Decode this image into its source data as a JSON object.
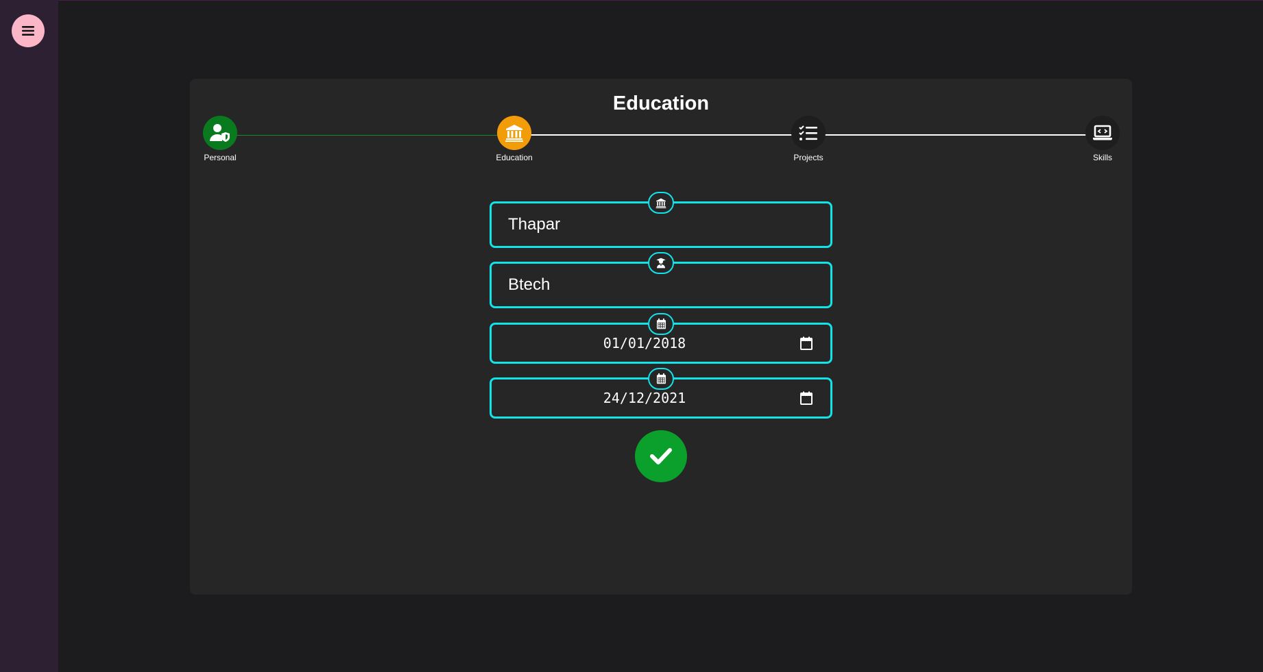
{
  "page": {
    "title": "Education"
  },
  "menu": {
    "icon": "hamburger-icon"
  },
  "stepper": {
    "steps": [
      {
        "label": "Personal",
        "icon": "user-shield-icon",
        "status": "completed",
        "color": "#0a7a1f"
      },
      {
        "label": "Education",
        "icon": "institution-icon",
        "status": "active",
        "color": "#f29c09"
      },
      {
        "label": "Projects",
        "icon": "tasks-list-icon",
        "status": "pending",
        "color": "#1e1e1e"
      },
      {
        "label": "Skills",
        "icon": "laptop-code-icon",
        "status": "pending",
        "color": "#1e1e1e"
      }
    ],
    "completed_line_color": "#1a8c2c",
    "pending_line_color": "#ffffff"
  },
  "form": {
    "institution": {
      "value": "Thapar",
      "icon": "institution-icon"
    },
    "degree": {
      "value": "Btech",
      "icon": "graduate-icon"
    },
    "start_date": {
      "value": "01/01/2018",
      "icon": "calendar-icon"
    },
    "end_date": {
      "value": "24/12/2021",
      "icon": "calendar-icon"
    },
    "accent_color": "#12e3e8"
  },
  "submit": {
    "icon": "check-icon",
    "color": "#0b9f2c"
  }
}
